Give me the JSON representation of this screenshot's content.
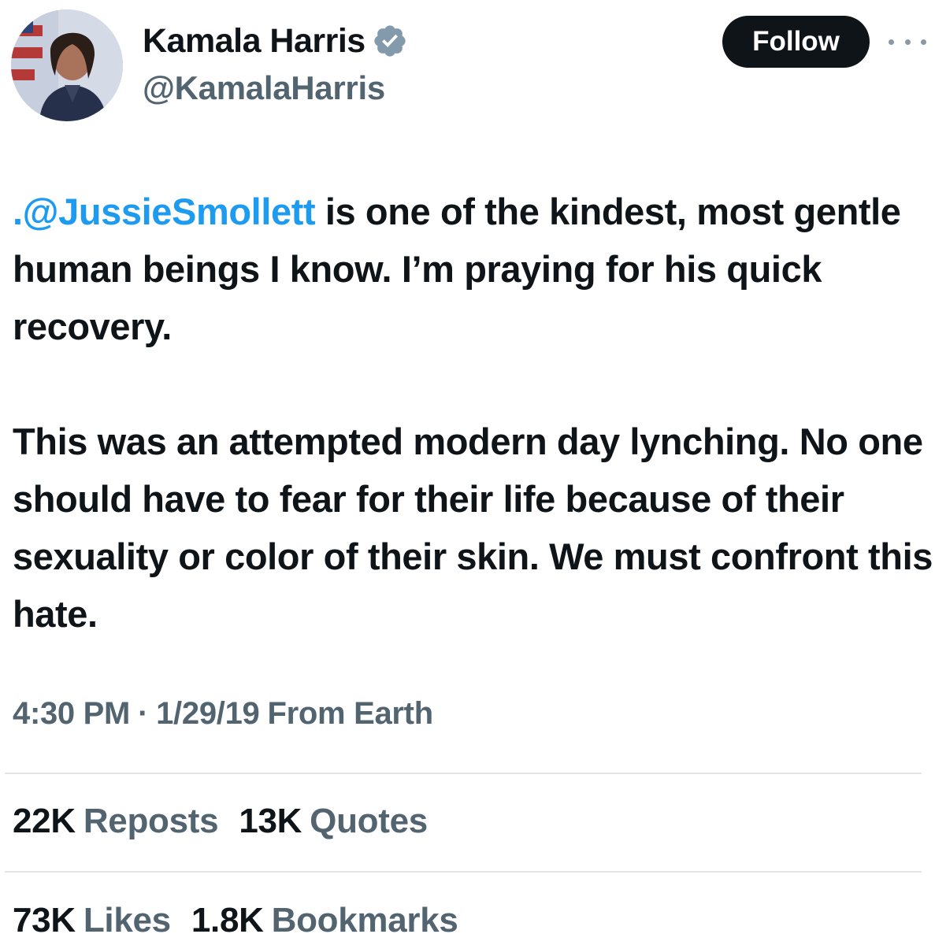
{
  "author": {
    "display_name": "Kamala Harris",
    "handle": "@KamalaHarris",
    "verified": true,
    "avatar_icon": "profile-photo"
  },
  "actions": {
    "follow_label": "Follow",
    "more_icon": "more-horizontal-icon"
  },
  "tweet": {
    "mention": ".@JussieSmollett",
    "text_after_mention": " is one of the kindest, most gentle human beings I know. I’m praying for his quick recovery.\n\nThis was an attempted modern day lynching. No one should have to fear for their life because of their sexuality or color of their skin. We must confront this hate."
  },
  "meta": {
    "time": "4:30 PM",
    "separator": "·",
    "date": "1/29/19",
    "source": "From Earth"
  },
  "stats": {
    "reposts": {
      "count": "22K",
      "label": "Reposts"
    },
    "quotes": {
      "count": "13K",
      "label": "Quotes"
    },
    "likes": {
      "count": "73K",
      "label": "Likes"
    },
    "bookmarks": {
      "count": "1.8K",
      "label": "Bookmarks"
    }
  },
  "colors": {
    "mention": "#1d9bf0",
    "secondary_text": "#536471",
    "verified_badge": "#829aab",
    "follow_bg": "#0f1419"
  }
}
